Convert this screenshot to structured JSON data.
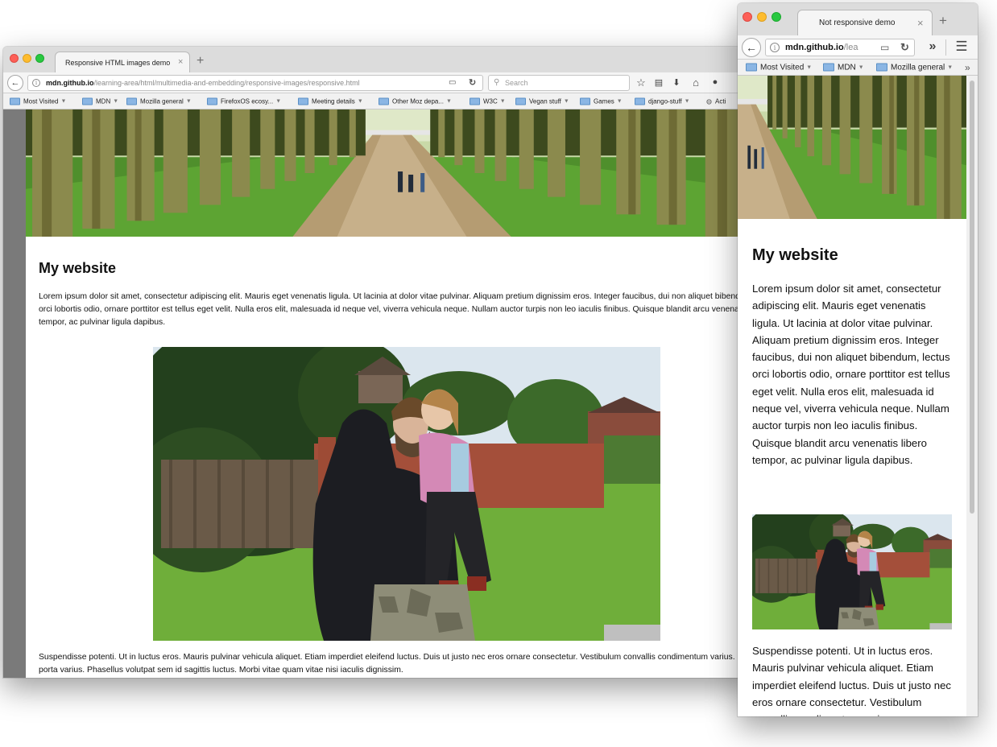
{
  "large_window": {
    "tab_title": "Responsive HTML images demo",
    "tab_close": "×",
    "new_tab": "+",
    "url_host": "mdn.github.io",
    "url_path": "/learning-area/html/multimedia-and-embedding/responsive-images/responsive.html",
    "search_placeholder": "Search",
    "bookmarks": [
      "Most Visited",
      "MDN",
      "Mozilla general",
      "FirefoxOS ecosy...",
      "Meeting details",
      "Other Moz depa...",
      "W3C",
      "Vegan stuff",
      "Games",
      "django-stuff",
      "Acti"
    ],
    "page": {
      "heading": "My website",
      "para1": "Lorem ipsum dolor sit amet, consectetur adipiscing elit. Mauris eget venenatis ligula. Ut lacinia at dolor vitae pulvinar. Aliquam pretium dignissim eros. Integer faucibus, dui non aliquet bibendum, lectus orci lobortis odio, ornare porttitor est tellus eget velit. Nulla eros elit, malesuada id neque vel, viverra vehicula neque. Nullam auctor turpis non leo iaculis finibus. Quisque blandit arcu venenatis libero tempor, ac pulvinar ligula dapibus.",
      "para2": "Suspendisse potenti. Ut in luctus eros. Mauris pulvinar vehicula aliquet. Etiam imperdiet eleifend luctus. Duis ut justo nec eros ornare consectetur. Vestibulum convallis condimentum varius. Maecenas rutrum porta varius. Phasellus volutpat sem id sagittis luctus. Morbi vitae quam vitae nisi iaculis dignissim."
    }
  },
  "small_window": {
    "tab_title": "Not responsive demo",
    "tab_close": "×",
    "new_tab": "+",
    "url_host": "mdn.github.io",
    "url_path": "/lea",
    "overflow": "»",
    "bookmarks": [
      "Most Visited",
      "MDN",
      "Mozilla general"
    ],
    "bookmarks_overflow": "»",
    "page": {
      "heading": "My website",
      "para1": "Lorem ipsum dolor sit amet, consectetur adipiscing elit. Mauris eget venenatis ligula. Ut lacinia at dolor vitae pulvinar. Aliquam pretium dignissim eros. Integer faucibus, dui non aliquet bibendum, lectus orci lobortis odio, ornare porttitor est tellus eget velit. Nulla eros elit, malesuada id neque vel, viverra vehicula neque. Nullam auctor turpis non leo iaculis finibus. Quisque blandit arcu venenatis libero tempor, ac pulvinar ligula dapibus.",
      "para2": "Suspendisse potenti. Ut in luctus eros. Mauris pulvinar vehicula aliquet. Etiam imperdiet eleifend luctus. Duis ut justo nec eros ornare consectetur. Vestibulum convallis condimentum varius."
    }
  },
  "icons": {
    "back": "←",
    "info": "i",
    "reader": "▭",
    "reload": "↻",
    "search": "⚲",
    "star": "☆",
    "library": "▤",
    "download": "⬇",
    "home": "⌂",
    "chat": "●",
    "menu": "☰"
  },
  "colors": {
    "close": "#fd5f57",
    "minimize": "#febc2e",
    "maximize": "#28c840",
    "bookmark_folder": "#8bb6e4"
  }
}
